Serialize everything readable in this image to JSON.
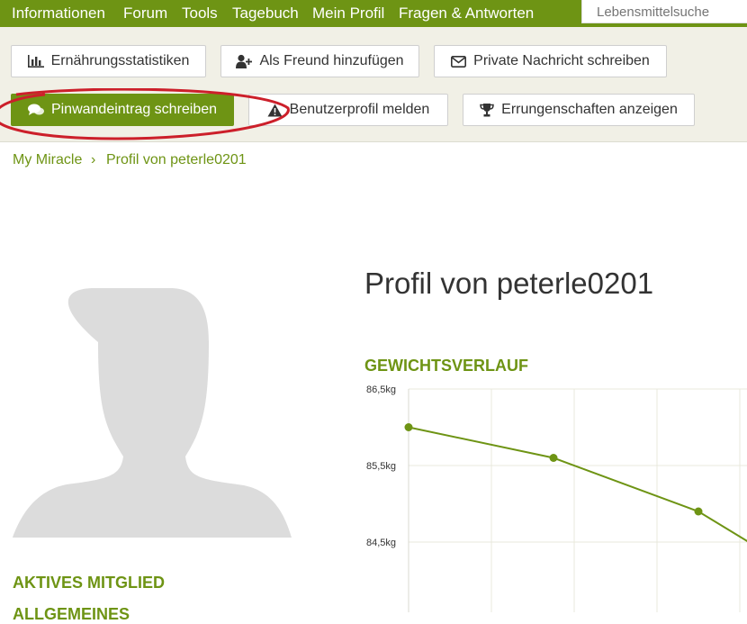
{
  "nav": {
    "items": [
      "Informationen",
      "Forum",
      "Tools",
      "Tagebuch",
      "Mein Profil",
      "Fragen & Antworten"
    ],
    "search_placeholder": "Lebensmittelsuche"
  },
  "actions": {
    "nutrition_stats": "Ernährungsstatistiken",
    "add_friend": "Als Freund hinzufügen",
    "private_message": "Private Nachricht schreiben",
    "wall_post": "Pinwandeintrag schreiben",
    "report_profile": "Benutzerprofil melden",
    "achievements": "Errungenschaften anzeigen"
  },
  "breadcrumb": {
    "home": "My Miracle",
    "separator": "›",
    "current": "Profil von peterle0201"
  },
  "profile": {
    "title": "Profil von peterle0201",
    "status": "AKTIVES MITGLIED",
    "general": "ALLGEMEINES"
  },
  "weight_chart": {
    "heading": "GEWICHTSVERLAUF",
    "line_color": "#6e9414",
    "grid_color": "#e8e8dc"
  },
  "chart_data": {
    "type": "line",
    "title": "GEWICHTSVERLAUF",
    "y_ticks": [
      "86,5kg",
      "85,5kg",
      "84,5kg"
    ],
    "ylim": [
      84.5,
      86.5
    ],
    "series": [
      {
        "values": [
          86.0,
          85.6,
          84.9,
          84.5
        ]
      }
    ],
    "grid": true
  },
  "colors": {
    "brand": "#6e9414",
    "toolbar_bg": "#f1f0e6",
    "highlight": "#cc1f2a"
  }
}
